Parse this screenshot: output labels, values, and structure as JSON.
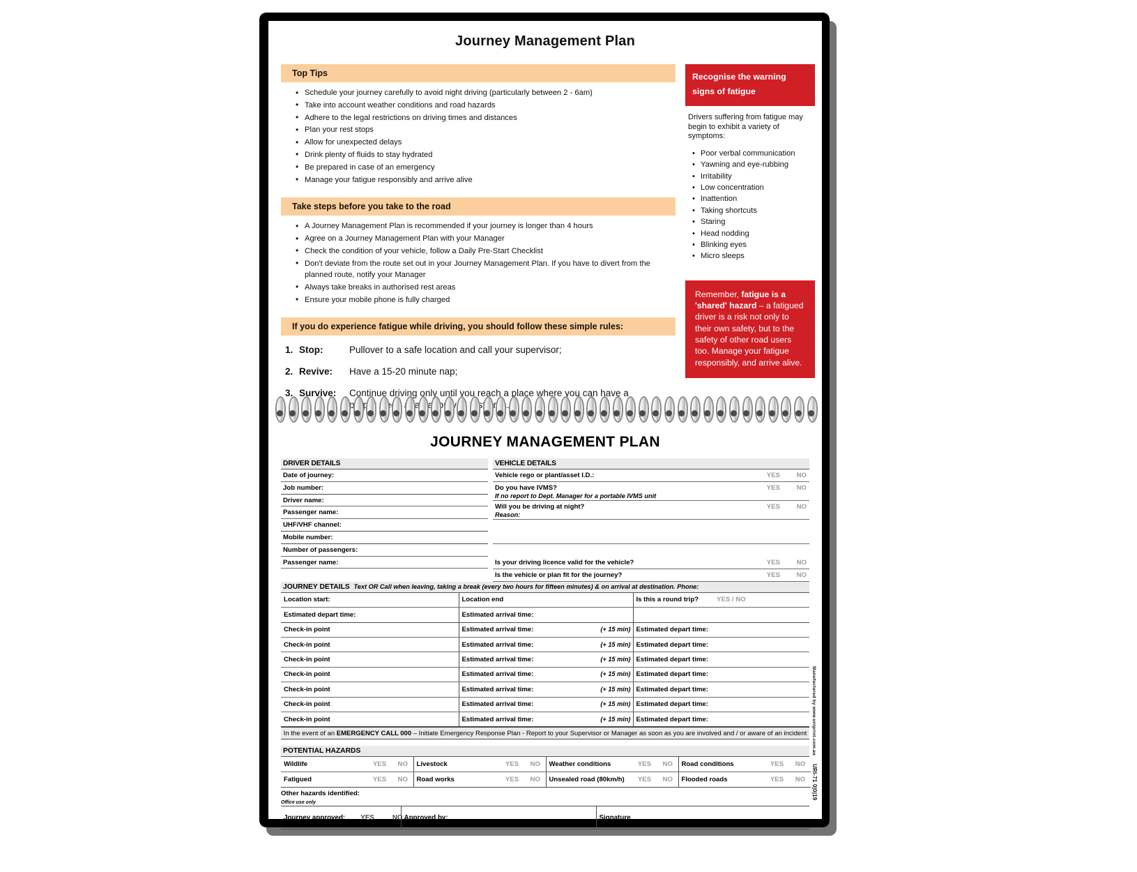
{
  "document": {
    "cover_title": "Journey Management Plan",
    "form_title": "JOURNEY MANAGEMENT PLAN"
  },
  "colors": {
    "band": "#fbcf9d",
    "red": "#d01f25",
    "header_grey": "#eaeaea",
    "cover": "#000000"
  },
  "top_tips": {
    "heading": "Top Tips",
    "items": [
      "Schedule your journey carefully to avoid night driving (particularly between 2 - 6am)",
      "Take into account weather conditions and road hazards",
      "Adhere to the legal restrictions on driving times and distances",
      "Plan your rest stops",
      "Allow for unexpected delays",
      "Drink plenty of fluids to stay hydrated",
      "Be prepared in case of an emergency",
      "Manage your fatigue responsibly and arrive alive"
    ]
  },
  "take_steps": {
    "heading": "Take steps before you take to the road",
    "items": [
      "A Journey Management Plan is recommended if your journey is longer than 4 hours",
      "Agree on a Journey Management Plan with your Manager",
      "Check the condition of your vehicle, follow a Daily Pre-Start Checklist",
      "Don't deviate from the route set out in your Journey Management Plan. If you have to divert from the planned route, notify your Manager",
      "Always take breaks in authorised rest areas",
      "Ensure your mobile phone is fully charged"
    ]
  },
  "fatigue_rules": {
    "heading": "If you do experience fatigue while driving, you should follow these simple rules:",
    "items": [
      {
        "num": "1.",
        "word": "Stop:",
        "text": "Pullover to a safe location and call your supervisor;"
      },
      {
        "num": "2.",
        "word": "Revive:",
        "text": "Have a 15-20 minute nap;"
      },
      {
        "num": "3.",
        "word": "Survive:",
        "text": "Continue driving only until you reach a place where you can have a proper sleep at an approved rest area."
      }
    ]
  },
  "warning_panel": {
    "heading_line1": "Recognise the warning",
    "heading_line2": "signs of fatigue",
    "intro": "Drivers suffering from fatigue may begin to exhibit a variety of symptoms:",
    "signs": [
      "Poor verbal communication",
      "Yawning and eye-rubbing",
      "Irritability",
      "Low concentration",
      "Inattention",
      "Taking shortcuts",
      "Staring",
      "Head nodding",
      "Blinking eyes",
      "Micro sleeps"
    ]
  },
  "remember_note": {
    "lead": "Remember, ",
    "bold": "fatigue is a 'shared' hazard",
    "rest": " – a fatigued driver is a risk not only to their own safety, but to the safety of other road users too. Manage your fatigue responsibly, and arrive alive."
  },
  "driver_details": {
    "heading": "DRIVER DETAILS",
    "fields": [
      "Date of journey:",
      "Job number:",
      "Driver name:",
      "Passenger name:",
      "UHF/VHF channel:",
      "Mobile number:",
      "Number of passengers:",
      "Passenger name:"
    ]
  },
  "vehicle_details": {
    "heading": "VEHICLE DETAILS",
    "yes": "YES",
    "no": "NO",
    "rows": [
      {
        "label": "Vehicle rego or plant/asset I.D.:",
        "sub": "",
        "yn": true
      },
      {
        "label": "Do you have IVMS?",
        "sub": "If no report to Dept. Manager for a portable IVMS unit",
        "yn": true
      },
      {
        "label": "Will you be driving at night?",
        "sub": "Reason:",
        "yn": true
      },
      {
        "label": "",
        "sub": "",
        "yn": false
      },
      {
        "label": "Is your driving licence valid for the vehicle?",
        "sub": "",
        "yn": true
      },
      {
        "label": "Is the vehicle or plan fit for the journey?",
        "sub": "",
        "yn": true
      }
    ]
  },
  "journey_details": {
    "heading": "JOURNEY DETAILS",
    "note": "Text OR Call when leaving, taking a break (every two hours for fifteen minutes) & on arrival at destination. Phone:",
    "location_start": "Location start:",
    "location_end": "Location end",
    "round_trip_label": "Is this a round trip?",
    "round_trip_value": "YES / NO",
    "estimated_depart": "Estimated depart time:",
    "estimated_arrival": "Estimated arrival time:",
    "checkin_label": "Check-in point",
    "plus15": "(+ 15 min)",
    "checkin_rows": 7
  },
  "emergency": {
    "prefix": "In the event of an ",
    "bold": "EMERGENCY CALL 000",
    "suffix": " – Initiate Emergency Response Plan - Report to your Supervisor or Manager as soon as you are involved and / or aware of an incident"
  },
  "potential_hazards": {
    "heading": "POTENTIAL HAZARDS",
    "yes": "YES",
    "no": "NO",
    "row1": [
      "Wildlife",
      "Livestock",
      "Weather conditions",
      "Road conditions"
    ],
    "row2": [
      "Fatigued",
      "Road works",
      "Unsealed road (80km/h)",
      "Flooded roads"
    ],
    "other_label": "Other hazards identified:",
    "office_use": "Office use only"
  },
  "approval": {
    "label": "Journey approved:",
    "yes": "YES",
    "no": "NO",
    "approved_by": "Approved by:",
    "signature": "Signature"
  },
  "margin": {
    "manufacturer": "Manufactured by www.uniprint.com.au",
    "code": "URI-71 0|0|19"
  }
}
